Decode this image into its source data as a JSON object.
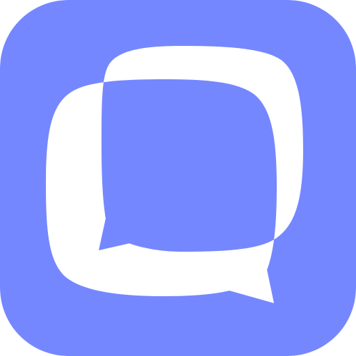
{
  "app_icon": {
    "icon_name": "two-overlapping-chat-bubbles-icon",
    "background_color": "#7587FF",
    "bubble_color": "#FFFFFF",
    "overlap_color": "#7587FF"
  }
}
